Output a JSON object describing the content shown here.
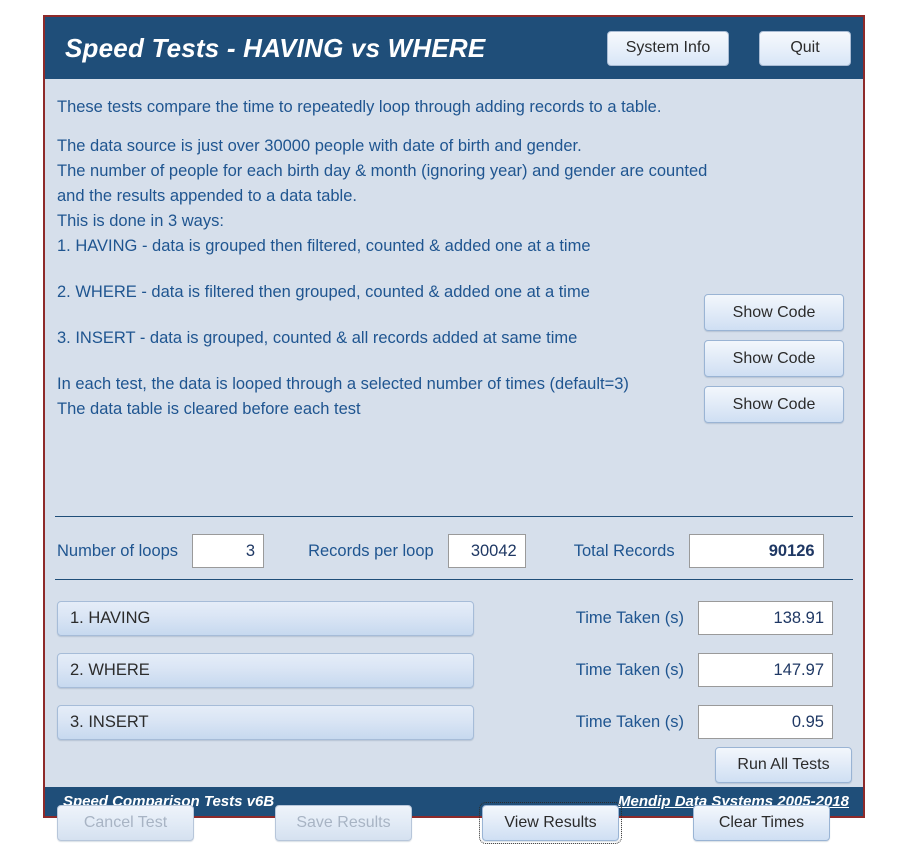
{
  "window": {
    "border_color": "#8e2a2a",
    "background": "#d6dfeb"
  },
  "header": {
    "title": "Speed Tests - HAVING vs WHERE",
    "background": "#1f4e79",
    "buttons": {
      "system_info": "System Info",
      "quit": "Quit"
    }
  },
  "description": {
    "text_color": "#1f5590",
    "lines": [
      "These tests compare the time to repeatedly loop through adding records to a table.",
      "The data source is just over 30000 people with date of birth and gender.",
      "The number of people for each birth day & month  (ignoring year) and gender are counted",
      "and the results appended to a data table.",
      "This is done in 3 ways:",
      "1. HAVING - data is grouped then filtered, counted & added one at a time",
      "2. WHERE - data is filtered then grouped, counted & added one at a time",
      "3. INSERT - data is grouped, counted & all records added at same time",
      "In each test, the data is looped through a selected number of times (default=3)",
      "The data table is cleared before each test"
    ]
  },
  "code_buttons": [
    {
      "label": "Show Code"
    },
    {
      "label": "Show Code"
    },
    {
      "label": "Show Code"
    }
  ],
  "counts": {
    "loops_label": "Number of loops",
    "loops_value": "3",
    "records_label": "Records per loop",
    "records_value": "30042",
    "total_label": "Total Records",
    "total_value": "90126"
  },
  "tests": [
    {
      "name": "1.  HAVING",
      "time_label": "Time Taken (s)",
      "time_value": "138.91"
    },
    {
      "name": "2.  WHERE",
      "time_label": "Time Taken (s)",
      "time_value": "147.97"
    },
    {
      "name": "3.  INSERT",
      "time_label": "Time Taken (s)",
      "time_value": "0.95"
    }
  ],
  "run_button": {
    "label": "Run All Tests"
  },
  "actions": {
    "cancel_test": "Cancel Test",
    "save_results": "Save Results",
    "view_results": "View Results",
    "clear_times": "Clear Times"
  },
  "footer": {
    "left": "Speed Comparison Tests   v6B",
    "link": "Mendip Data Systems 2005-2018",
    "background": "#1f4e79"
  }
}
